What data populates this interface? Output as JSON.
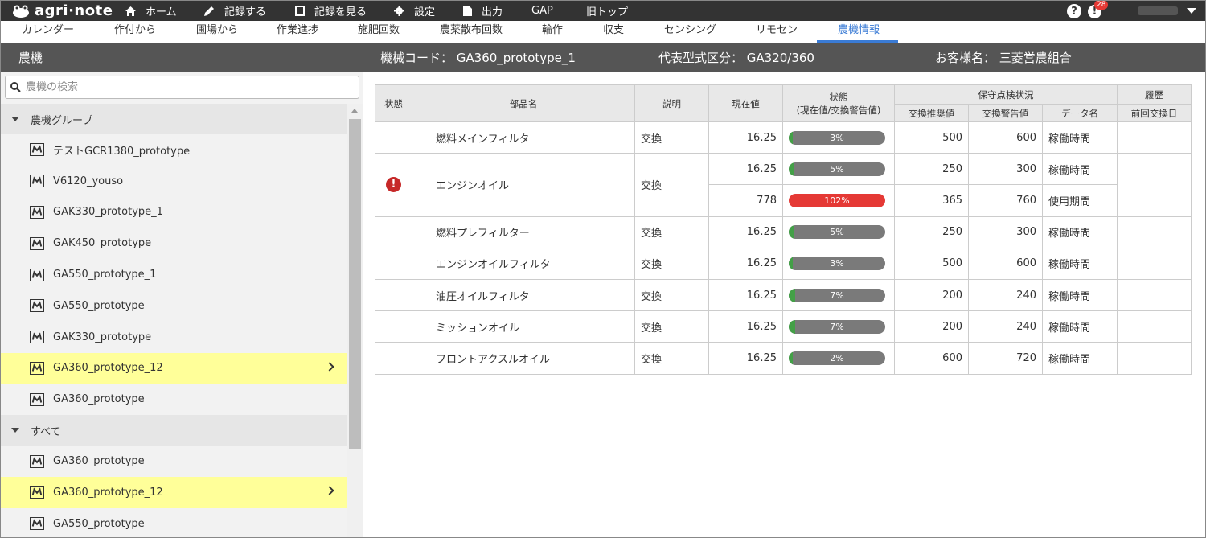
{
  "app": {
    "logo": "agri·note"
  },
  "topnav": [
    {
      "label": "ホーム",
      "icon": "home-icon"
    },
    {
      "label": "記録する",
      "icon": "pencil-icon"
    },
    {
      "label": "記録を見る",
      "icon": "notebook-icon"
    },
    {
      "label": "設定",
      "icon": "gear-icon"
    },
    {
      "label": "出力",
      "icon": "document-icon"
    },
    {
      "label": "GAP"
    },
    {
      "label": "旧トップ"
    }
  ],
  "notifications": {
    "count": "28"
  },
  "subnav": [
    "カレンダー",
    "作付から",
    "圃場から",
    "作業進捗",
    "施肥回数",
    "農薬散布回数",
    "輪作",
    "収支",
    "センシング",
    "リモセン",
    "農機情報"
  ],
  "header": {
    "section": "農機",
    "machine_code": "機械コード： GA360_prototype_1",
    "model_class": "代表型式区分： GA320/360",
    "customer": "お客様名： 三菱営農組合"
  },
  "search": {
    "placeholder": "農機の検索"
  },
  "groups": [
    {
      "label": "農機グループ",
      "items": [
        {
          "label": "テストGCR1380_prototype",
          "selected": false
        },
        {
          "label": "V6120_youso",
          "selected": false
        },
        {
          "label": "GAK330_prototype_1",
          "selected": false
        },
        {
          "label": "GAK450_prototype",
          "selected": false
        },
        {
          "label": "GA550_prototype_1",
          "selected": false
        },
        {
          "label": "GA550_prototype",
          "selected": false
        },
        {
          "label": "GAK330_prototype",
          "selected": false
        },
        {
          "label": "GA360_prototype_12",
          "selected": true
        },
        {
          "label": "GA360_prototype",
          "selected": false
        }
      ]
    },
    {
      "label": "すべて",
      "items": [
        {
          "label": "GA360_prototype",
          "selected": false
        },
        {
          "label": "GA360_prototype_12",
          "selected": true
        },
        {
          "label": "GA550_prototype",
          "selected": false
        }
      ]
    }
  ],
  "table": {
    "headers": {
      "status": "状態",
      "part": "部品名",
      "description": "説明",
      "current": "現在値",
      "ratio_line1": "状態",
      "ratio_line2": "(現在値/交換警告値)",
      "maintenance": "保守点検状況",
      "recommended": "交換推奨値",
      "warning": "交換警告値",
      "dataname": "データ名",
      "history": "履歴",
      "last_replaced": "前回交換日"
    },
    "rows": [
      {
        "alert": false,
        "part": "燃料メインフィルタ",
        "desc": "交換",
        "lines": [
          {
            "current": "16.25",
            "pct": 3,
            "pct_label": "3%",
            "recommended": "500",
            "warning": "600",
            "dataname": "稼働時間"
          }
        ]
      },
      {
        "alert": true,
        "part": "エンジンオイル",
        "desc": "交換",
        "lines": [
          {
            "current": "16.25",
            "pct": 5,
            "pct_label": "5%",
            "recommended": "250",
            "warning": "300",
            "dataname": "稼働時間"
          },
          {
            "current": "778",
            "pct": 102,
            "pct_label": "102%",
            "recommended": "365",
            "warning": "760",
            "dataname": "使用期間"
          }
        ]
      },
      {
        "alert": false,
        "part": "燃料プレフィルター",
        "desc": "交換",
        "lines": [
          {
            "current": "16.25",
            "pct": 5,
            "pct_label": "5%",
            "recommended": "250",
            "warning": "300",
            "dataname": "稼働時間"
          }
        ]
      },
      {
        "alert": false,
        "part": "エンジンオイルフィルタ",
        "desc": "交換",
        "lines": [
          {
            "current": "16.25",
            "pct": 3,
            "pct_label": "3%",
            "recommended": "500",
            "warning": "600",
            "dataname": "稼働時間"
          }
        ]
      },
      {
        "alert": false,
        "part": "油圧オイルフィルタ",
        "desc": "交換",
        "lines": [
          {
            "current": "16.25",
            "pct": 7,
            "pct_label": "7%",
            "recommended": "200",
            "warning": "240",
            "dataname": "稼働時間"
          }
        ]
      },
      {
        "alert": false,
        "part": "ミッションオイル",
        "desc": "交換",
        "lines": [
          {
            "current": "16.25",
            "pct": 7,
            "pct_label": "7%",
            "recommended": "200",
            "warning": "240",
            "dataname": "稼働時間"
          }
        ]
      },
      {
        "alert": false,
        "part": "フロントアクスルオイル",
        "desc": "交換",
        "lines": [
          {
            "current": "16.25",
            "pct": 2,
            "pct_label": "2%",
            "recommended": "600",
            "warning": "720",
            "dataname": "稼働時間"
          }
        ]
      }
    ]
  },
  "colors": {
    "accent": "#3a7bd5",
    "ok": "#43a047",
    "danger": "#e53935",
    "alert": "#c62828",
    "selected": "#ffff99"
  }
}
